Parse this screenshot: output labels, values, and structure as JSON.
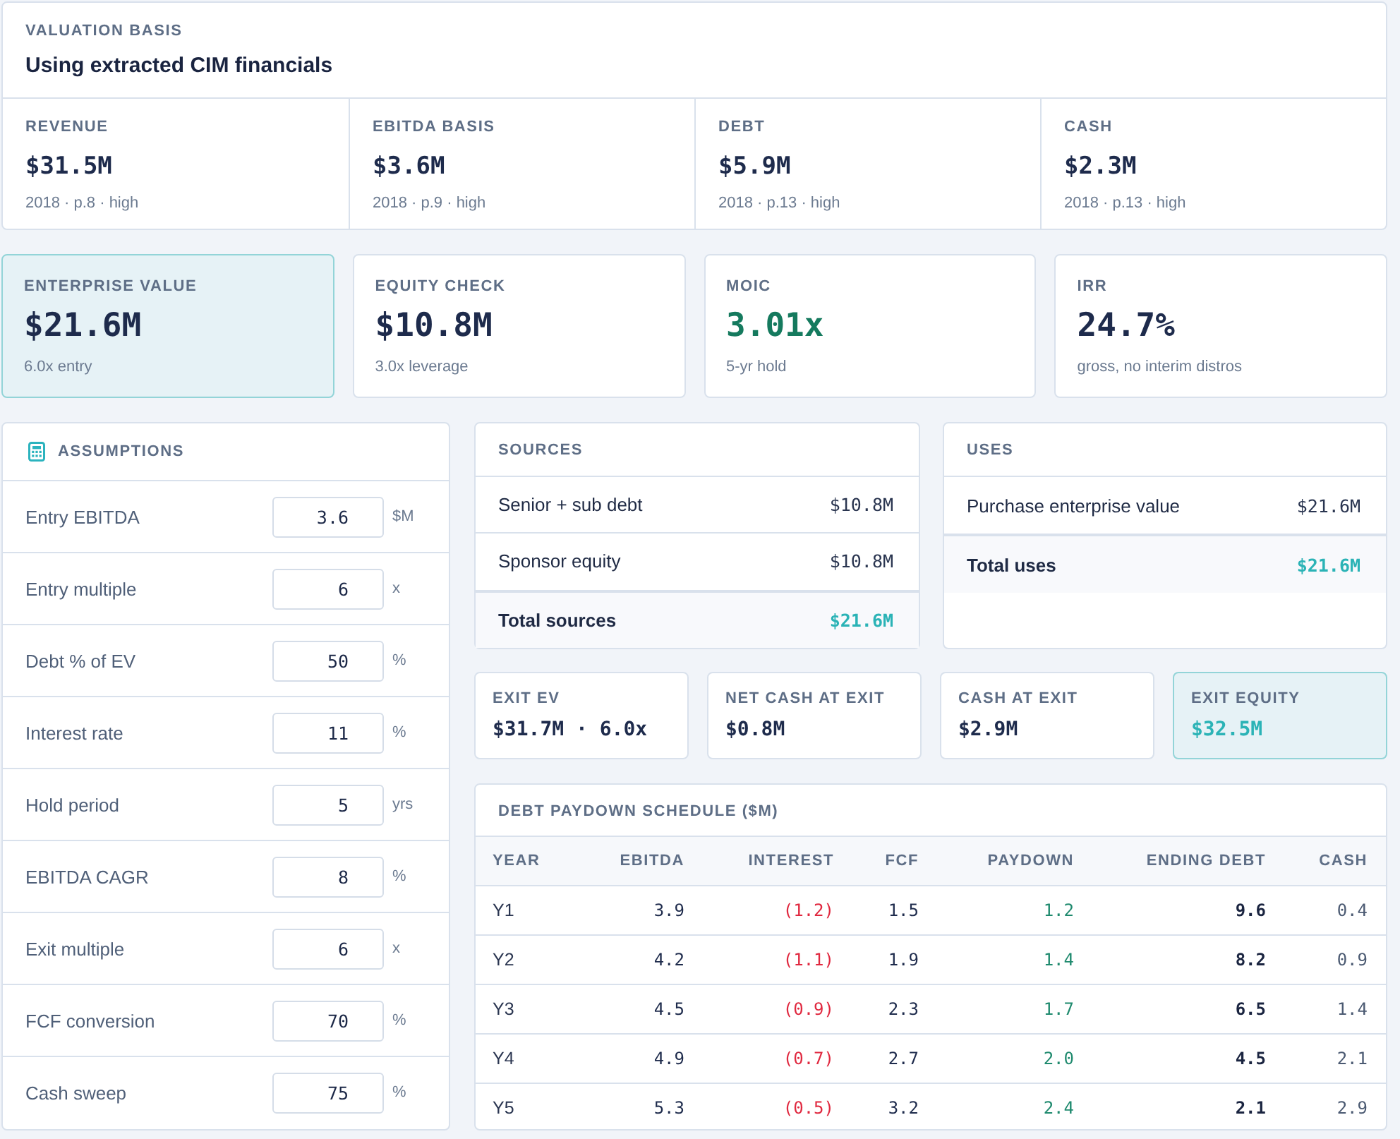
{
  "valuation_basis": {
    "label": "VALUATION BASIS",
    "title": "Using extracted CIM financials",
    "metrics": [
      {
        "label": "REVENUE",
        "value": "$31.5M",
        "source": "2018 · p.8 · high"
      },
      {
        "label": "EBITDA BASIS",
        "value": "$3.6M",
        "source": "2018 · p.9 · high"
      },
      {
        "label": "DEBT",
        "value": "$5.9M",
        "source": "2018 · p.13 · high"
      },
      {
        "label": "CASH",
        "value": "$2.3M",
        "source": "2018 · p.13 · high"
      }
    ]
  },
  "kpis": [
    {
      "label": "ENTERPRISE VALUE",
      "value": "$21.6M",
      "note": "6.0x entry",
      "highlighted": true,
      "kind": "default"
    },
    {
      "label": "EQUITY CHECK",
      "value": "$10.8M",
      "note": "3.0x leverage",
      "highlighted": false,
      "kind": "default"
    },
    {
      "label": "MOIC",
      "value": "3.01x",
      "note": "5-yr hold",
      "highlighted": false,
      "kind": "positive"
    },
    {
      "label": "IRR",
      "value": "24.7%",
      "note": "gross, no interim distros",
      "highlighted": false,
      "kind": "default"
    }
  ],
  "assumptions": {
    "title": "ASSUMPTIONS",
    "rows": [
      {
        "label": "Entry EBITDA",
        "value": "3.6",
        "unit": "$M"
      },
      {
        "label": "Entry multiple",
        "value": "6",
        "unit": "x"
      },
      {
        "label": "Debt % of EV",
        "value": "50",
        "unit": "%"
      },
      {
        "label": "Interest rate",
        "value": "11",
        "unit": "%"
      },
      {
        "label": "Hold period",
        "value": "5",
        "unit": "yrs"
      },
      {
        "label": "EBITDA CAGR",
        "value": "8",
        "unit": "%"
      },
      {
        "label": "Exit multiple",
        "value": "6",
        "unit": "x"
      },
      {
        "label": "FCF conversion",
        "value": "70",
        "unit": "%"
      },
      {
        "label": "Cash sweep",
        "value": "75",
        "unit": "%"
      }
    ]
  },
  "sources": {
    "title": "SOURCES",
    "rows": [
      {
        "label": "Senior + sub debt",
        "amount": "$10.8M"
      },
      {
        "label": "Sponsor equity",
        "amount": "$10.8M"
      }
    ],
    "total": {
      "label": "Total sources",
      "amount": "$21.6M"
    }
  },
  "uses": {
    "title": "USES",
    "rows": [
      {
        "label": "Purchase enterprise value",
        "amount": "$21.6M"
      }
    ],
    "total": {
      "label": "Total uses",
      "amount": "$21.6M"
    }
  },
  "exit_metrics": [
    {
      "label": "EXIT EV",
      "value": "$31.7M · 6.0x",
      "highlighted": false,
      "kind": "default"
    },
    {
      "label": "NET CASH AT EXIT",
      "value": "$0.8M",
      "highlighted": false,
      "kind": "default"
    },
    {
      "label": "CASH AT EXIT",
      "value": "$2.9M",
      "highlighted": false,
      "kind": "default"
    },
    {
      "label": "EXIT EQUITY",
      "value": "$32.5M",
      "highlighted": true,
      "kind": "accent"
    }
  ],
  "debt_schedule": {
    "title": "DEBT PAYDOWN SCHEDULE ($M)",
    "columns": [
      {
        "label": "YEAR",
        "kind": "label"
      },
      {
        "label": "EBITDA",
        "kind": "number"
      },
      {
        "label": "INTEREST",
        "kind": "negative"
      },
      {
        "label": "FCF",
        "kind": "number"
      },
      {
        "label": "PAYDOWN",
        "kind": "positive"
      },
      {
        "label": "ENDING DEBT",
        "kind": "strong"
      },
      {
        "label": "CASH",
        "kind": "muted"
      }
    ],
    "rows": [
      [
        "Y1",
        "3.9",
        "(1.2)",
        "1.5",
        "1.2",
        "9.6",
        "0.4"
      ],
      [
        "Y2",
        "4.2",
        "(1.1)",
        "1.9",
        "1.4",
        "8.2",
        "0.9"
      ],
      [
        "Y3",
        "4.5",
        "(0.9)",
        "2.3",
        "1.7",
        "6.5",
        "1.4"
      ],
      [
        "Y4",
        "4.9",
        "(0.7)",
        "2.7",
        "2.0",
        "4.5",
        "2.1"
      ],
      [
        "Y5",
        "5.3",
        "(0.5)",
        "3.2",
        "2.4",
        "2.1",
        "2.9"
      ]
    ]
  }
}
